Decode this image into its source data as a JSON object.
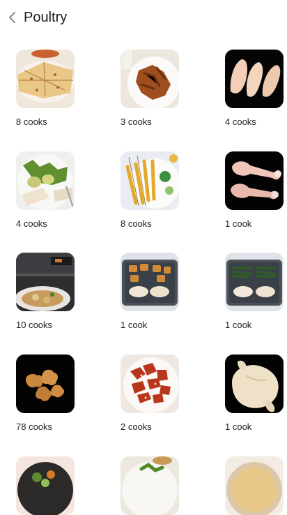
{
  "header": {
    "back_icon": "chevron-left-icon",
    "title": "Poultry"
  },
  "recipes": [
    {
      "id": "quesadilla",
      "cooks": "8 cooks"
    },
    {
      "id": "wings-plate",
      "cooks": "3 cooks"
    },
    {
      "id": "raw-breasts",
      "cooks": "4 cooks"
    },
    {
      "id": "salad-chicken",
      "cooks": "4 cooks"
    },
    {
      "id": "skewers",
      "cooks": "8 cooks"
    },
    {
      "id": "drumsticks",
      "cooks": "1 cook"
    },
    {
      "id": "oven-dish",
      "cooks": "10 cooks"
    },
    {
      "id": "sheet-pan-potatoes",
      "cooks": "1 cook"
    },
    {
      "id": "sheet-pan-greens",
      "cooks": "1 cook"
    },
    {
      "id": "nuggets",
      "cooks": "78 cooks"
    },
    {
      "id": "glazed-wings",
      "cooks": "2 cooks"
    },
    {
      "id": "whole-chicken",
      "cooks": "1 cook"
    },
    {
      "id": "bowl-salad",
      "cooks": ""
    },
    {
      "id": "herb-plate",
      "cooks": ""
    },
    {
      "id": "pot-pie",
      "cooks": ""
    }
  ]
}
